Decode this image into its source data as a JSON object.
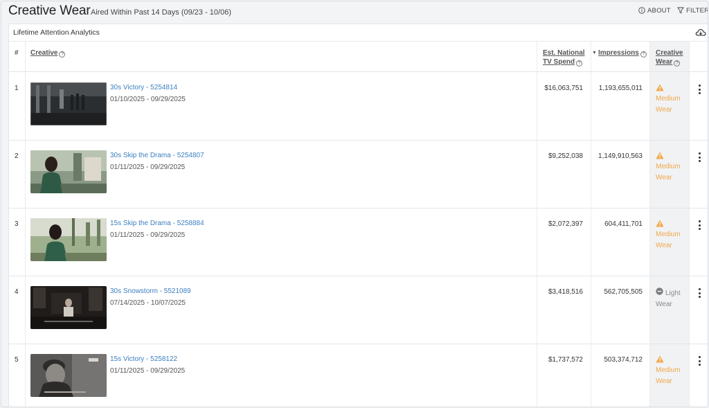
{
  "page": {
    "title": "Creative Wear",
    "subtitle": "Aired Within Past 14 Days (09/23 - 10/06)",
    "about_label": "ABOUT",
    "filter_label": "FILTER"
  },
  "panel": {
    "title": "Lifetime Attention Analytics"
  },
  "table": {
    "headers": {
      "num": "#",
      "creative": "Creative",
      "spend_line1": "Est. National",
      "spend_line2": "TV Spend",
      "impressions": "Impressions",
      "wear_line1": "Creative",
      "wear_line2": "Wear"
    },
    "sort_indicator": "descending-caret-icon",
    "rows": [
      {
        "num": "1",
        "name": "30s Victory - 5254814",
        "dates": "01/10/2025 - 09/29/2025",
        "spend": "$16,063,751",
        "impressions": "1,193,655,011",
        "wear_line1": "Medium",
        "wear_line2": "Wear",
        "wear_level": "medium"
      },
      {
        "num": "2",
        "name": "30s Skip the Drama - 5254807",
        "dates": "01/11/2025 - 09/29/2025",
        "spend": "$9,252,038",
        "impressions": "1,149,910,563",
        "wear_line1": "Medium",
        "wear_line2": "Wear",
        "wear_level": "medium"
      },
      {
        "num": "3",
        "name": "15s Skip the Drama - 5258884",
        "dates": "01/11/2025 - 09/29/2025",
        "spend": "$2,072,397",
        "impressions": "604,411,701",
        "wear_line1": "Medium",
        "wear_line2": "Wear",
        "wear_level": "medium"
      },
      {
        "num": "4",
        "name": "30s Snowstorm - 5521089",
        "dates": "07/14/2025 - 10/07/2025",
        "spend": "$3,418,516",
        "impressions": "562,705,505",
        "wear_line1": "Light",
        "wear_line2": "Wear",
        "wear_level": "light"
      },
      {
        "num": "5",
        "name": "15s Victory - 5258122",
        "dates": "01/11/2025 - 09/29/2025",
        "spend": "$1,737,572",
        "impressions": "503,374,712",
        "wear_line1": "Medium",
        "wear_line2": "Wear",
        "wear_level": "medium"
      }
    ]
  },
  "colors": {
    "link": "#3d7fc1",
    "medium_wear": "#f0a848",
    "light_wear": "#8a8a8a"
  },
  "icons": {
    "about": "info-circle-icon",
    "filter": "funnel-icon",
    "download": "cloud-download-icon",
    "help": "question-circle-icon",
    "medium_wear": "warning-triangle-icon",
    "light_wear": "minus-circle-icon",
    "row_menu": "vertical-ellipsis-icon"
  }
}
